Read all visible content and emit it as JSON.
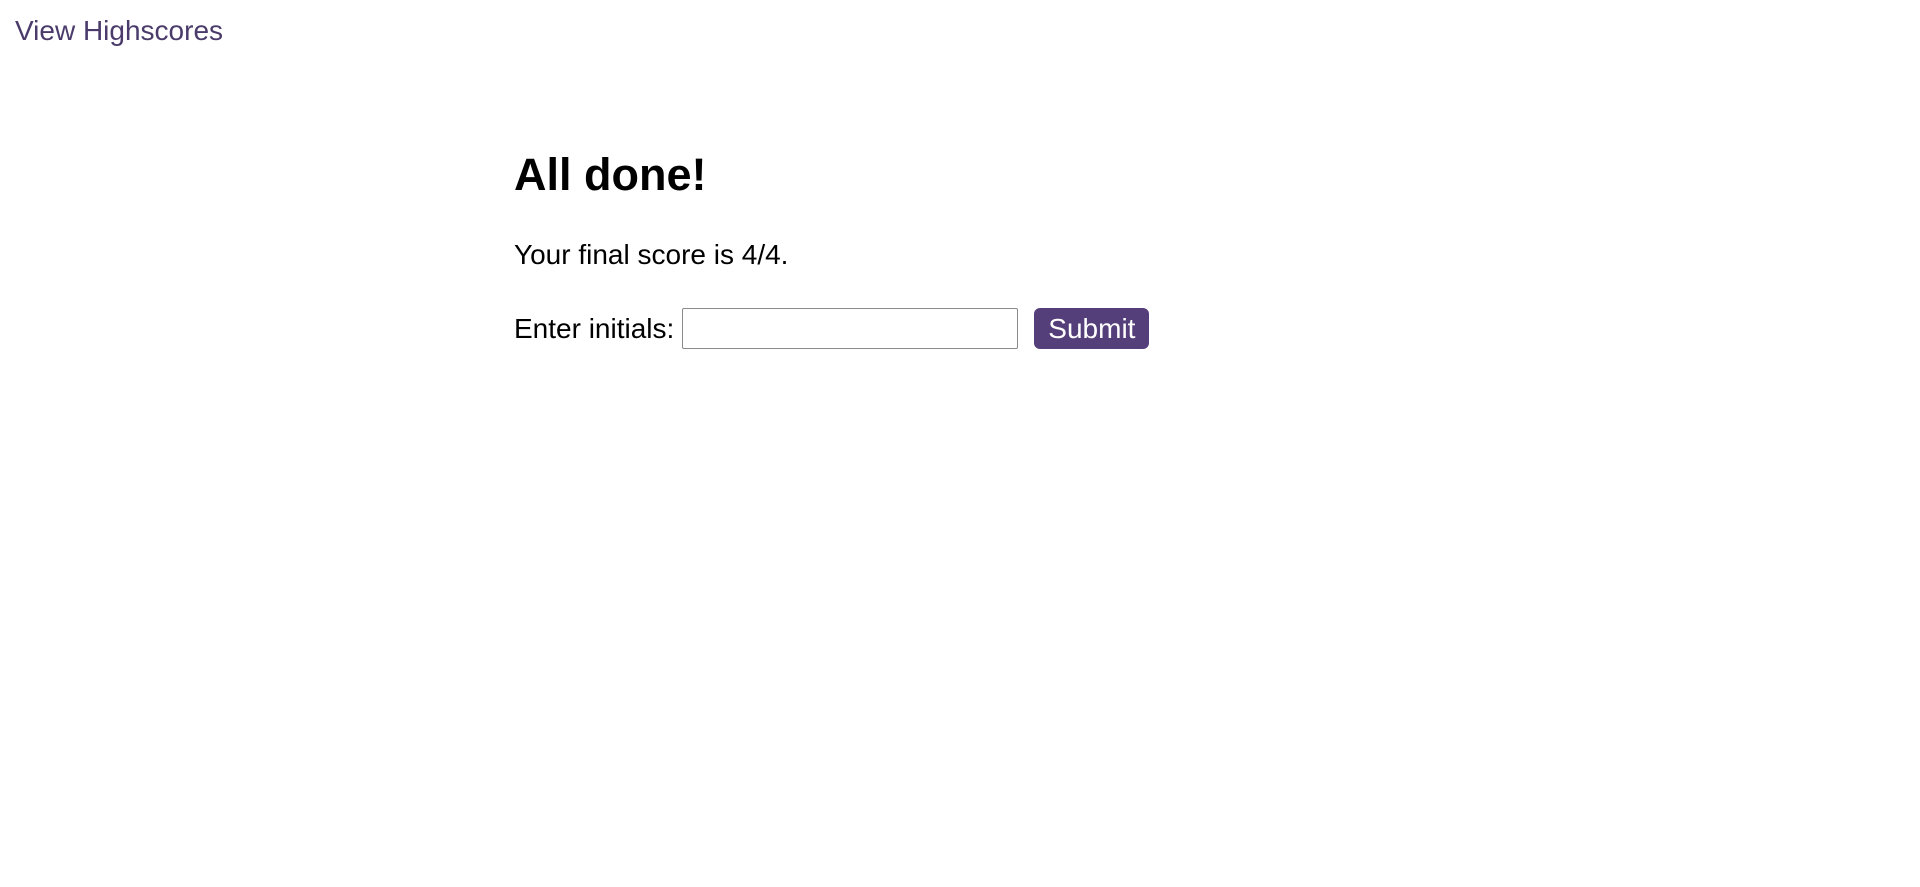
{
  "header": {
    "highscores_link": "View Highscores"
  },
  "main": {
    "title": "All done!",
    "score_text": "Your final score is 4/4.",
    "initials_label": "Enter initials:",
    "initials_value": "",
    "initials_placeholder": "",
    "submit_label": "Submit"
  },
  "colors": {
    "link": "#4a3b6b",
    "button_background": "#553f7a",
    "button_text": "#ffffff",
    "text": "#000000",
    "background": "#ffffff"
  }
}
